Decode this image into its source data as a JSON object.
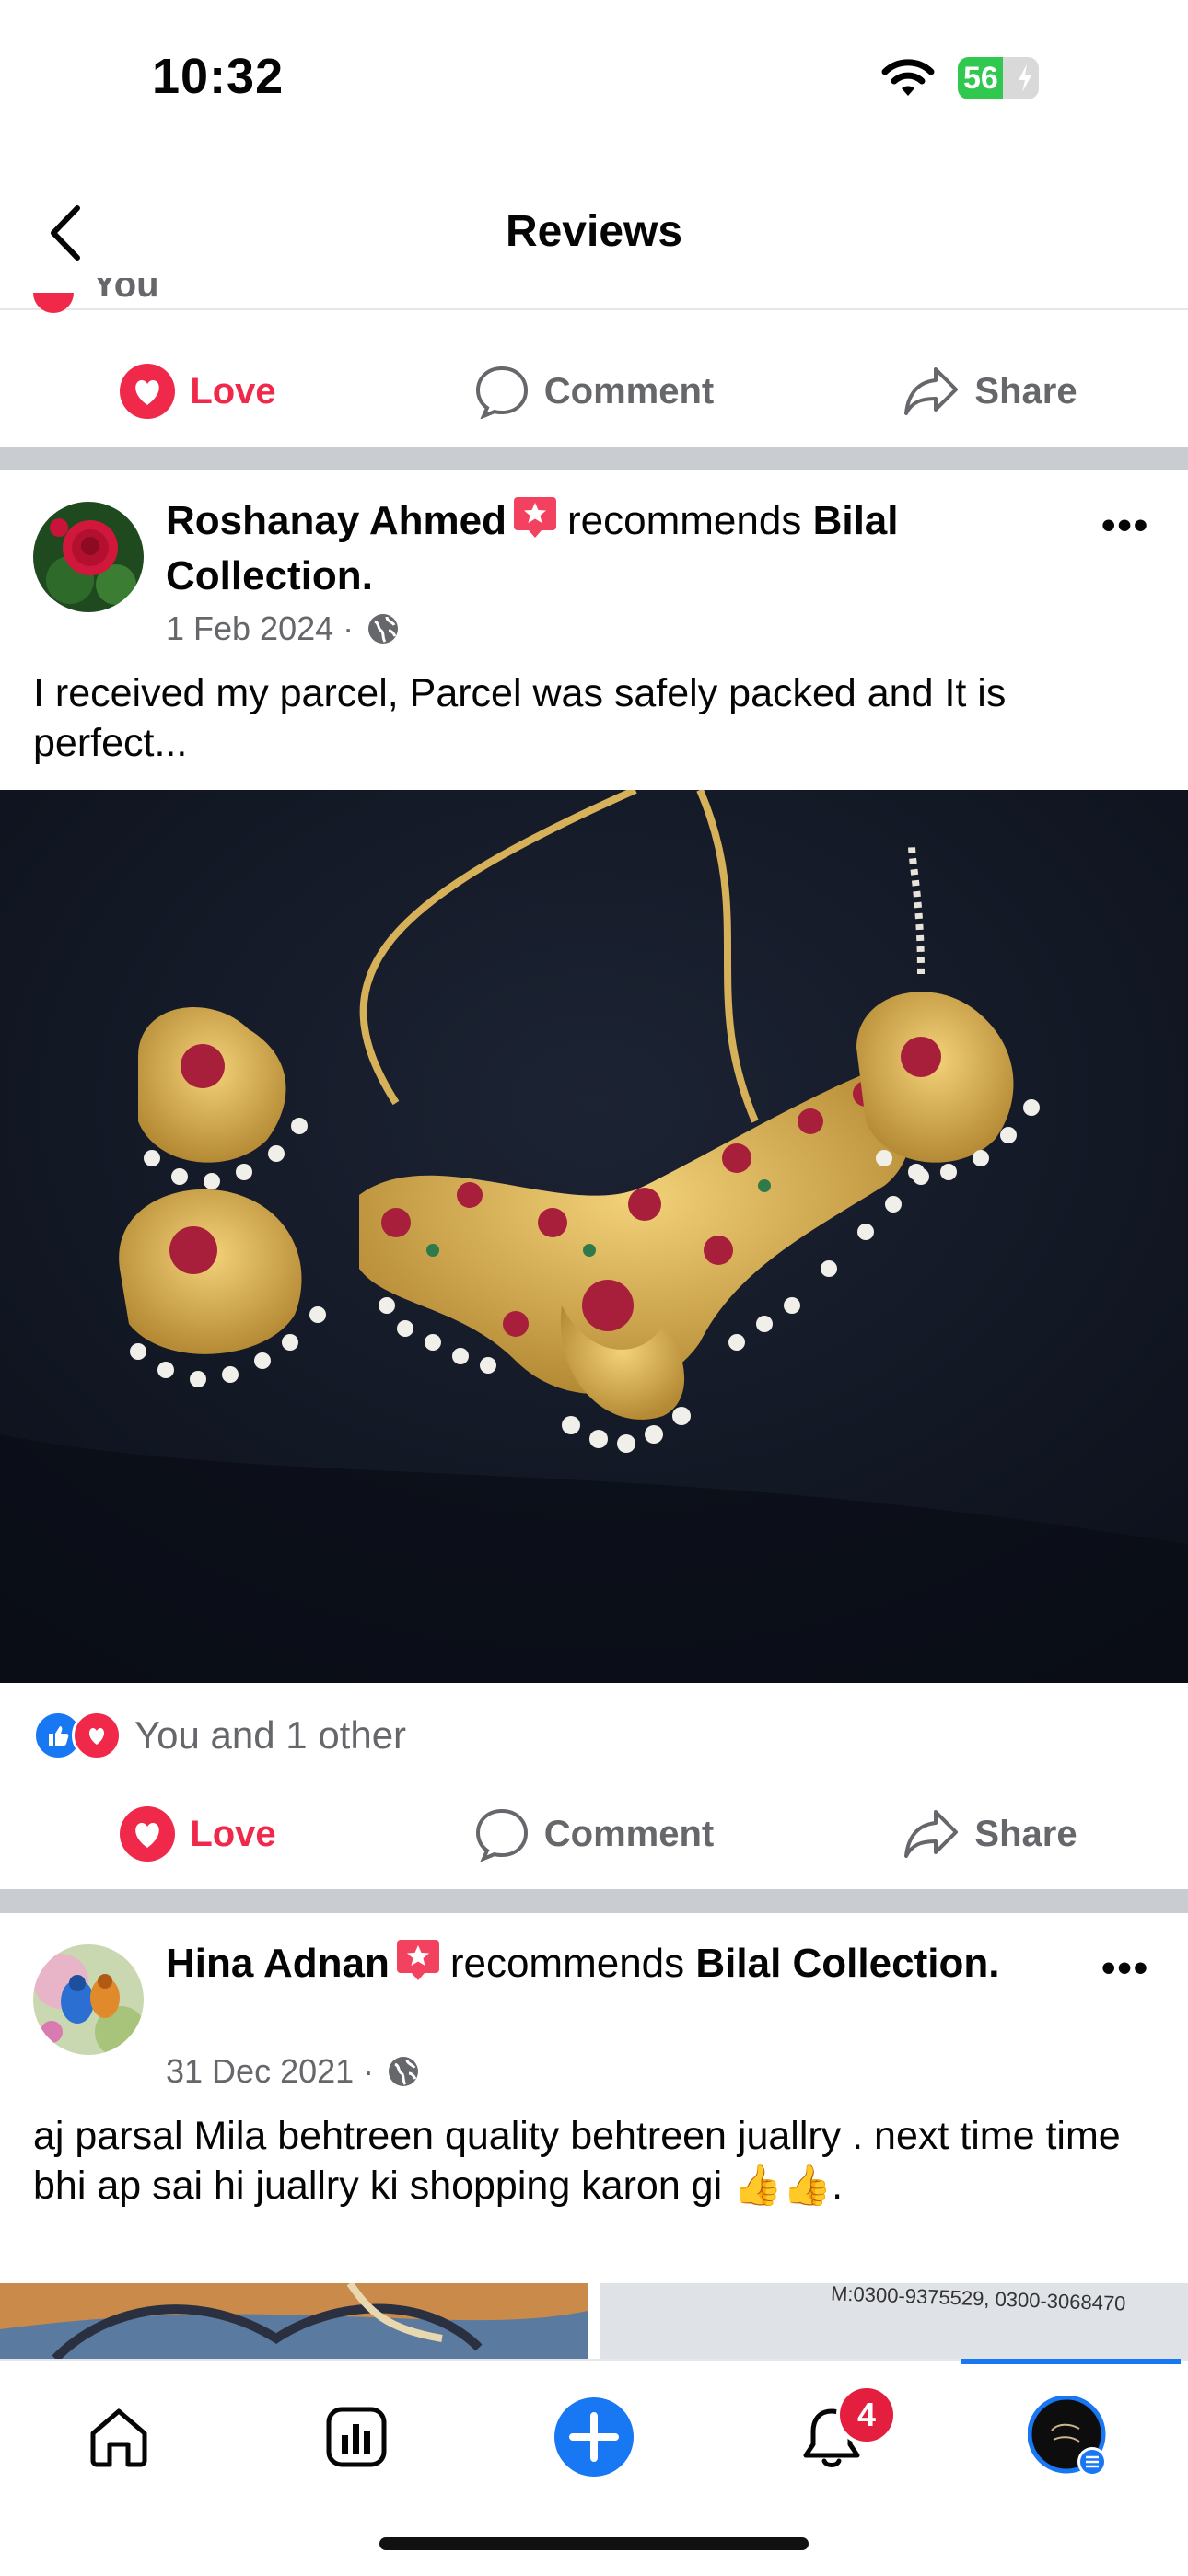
{
  "status": {
    "time": "10:32",
    "battery": "56"
  },
  "header": {
    "title": "Reviews"
  },
  "top_remnant": {
    "text": "You"
  },
  "actions": {
    "love": "Love",
    "comment": "Comment",
    "share": "Share"
  },
  "posts": [
    {
      "author": "Roshanay Ahmed",
      "recommends": "recommends",
      "page": "Bilal Collection",
      "date": "1 Feb 2024 ·",
      "text": "I received my parcel, Parcel was safely packed and It is perfect...",
      "reactions": "You and 1 other"
    },
    {
      "author": "Hina Adnan",
      "recommends": "recommends",
      "page": "Bilal Collection",
      "date": "31 Dec 2021 ·",
      "text": "aj parsal Mila behtreen quality behtreen juallry . next time time bhi ap sai hi juallry ki shopping karon gi 👍👍.",
      "photo_text": "M:0300-9375529, 0300-3068470"
    }
  ],
  "tabbar": {
    "notifications_count": "4"
  },
  "colors": {
    "love": "#f02849",
    "like": "#1877f2",
    "muted": "#65676b",
    "divider": "#c9ccd1"
  },
  "icons": [
    "back-chevron-icon",
    "wifi-icon",
    "battery-icon",
    "love-heart-icon",
    "comment-bubble-icon",
    "share-arrow-icon",
    "globe-icon",
    "star-badge-icon",
    "more-dots-icon",
    "home-icon",
    "dashboard-icon",
    "create-plus-icon",
    "bell-icon",
    "profile-avatar"
  ]
}
